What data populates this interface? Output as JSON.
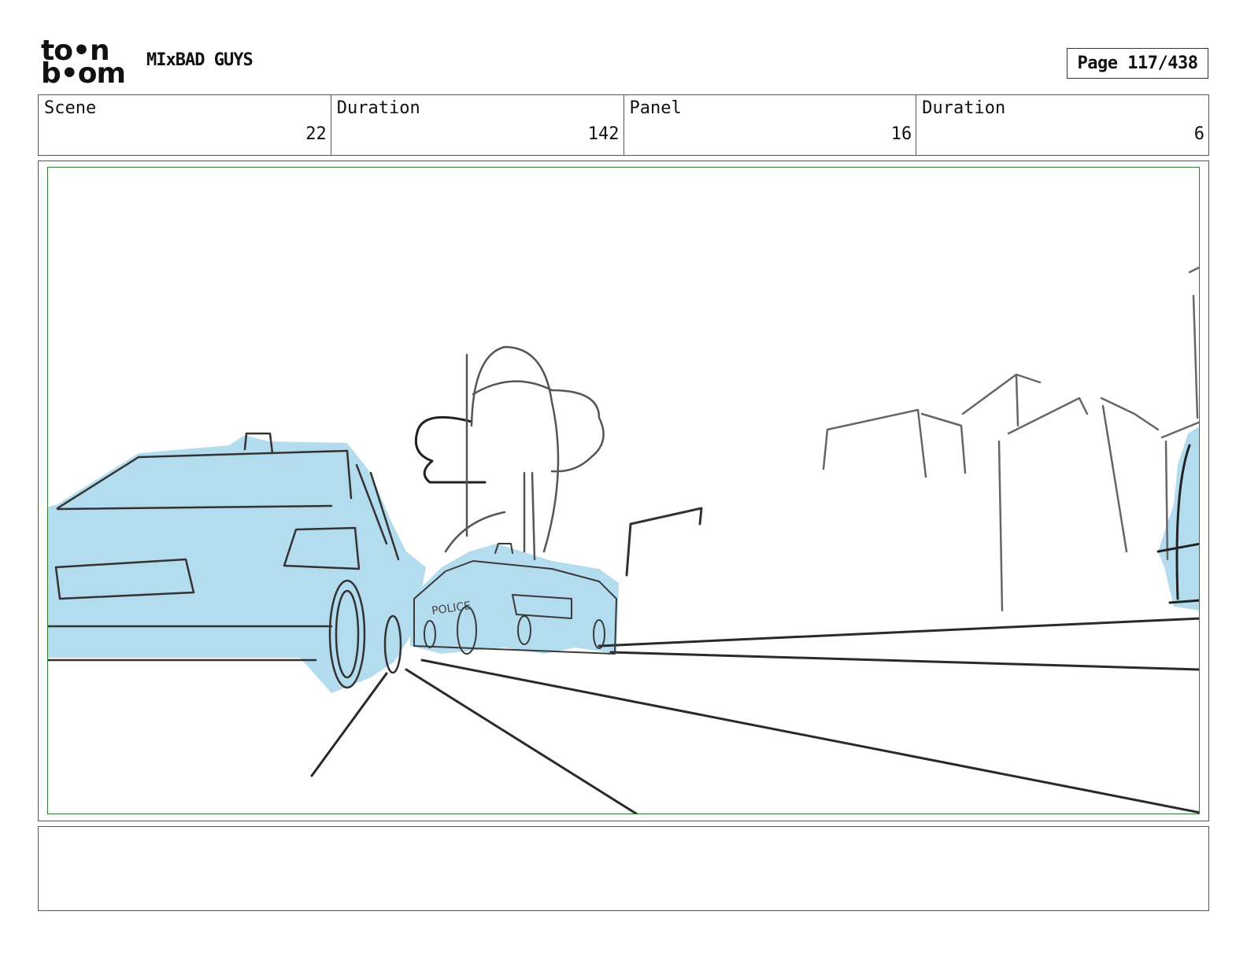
{
  "header": {
    "logo_line1": "to•n",
    "logo_line2": "b•om",
    "title": "MIxBAD GUYS",
    "page_label": "Page 117/438"
  },
  "info": {
    "scene_label": "Scene",
    "scene_value": "22",
    "scene_duration_label": "Duration",
    "scene_duration_value": "142",
    "panel_label": "Panel",
    "panel_value": "16",
    "panel_duration_label": "Duration",
    "panel_duration_value": "6"
  },
  "panel": {
    "fill_color": "#b3dcef",
    "safe_frame_color": "#2e7d32",
    "car_text": "POLICE"
  },
  "notes": {
    "text": ""
  }
}
